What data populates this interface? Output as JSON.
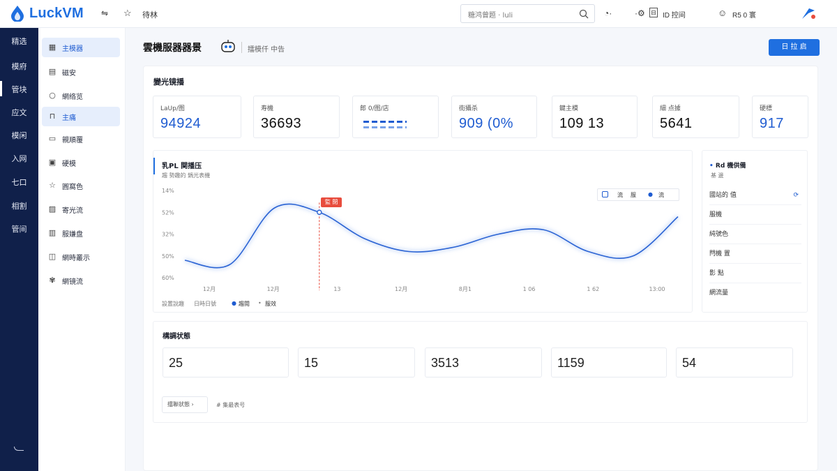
{
  "app": {
    "brand": "LuckVM"
  },
  "topbar": {
    "nav_label": "待林",
    "search_placeholder": "糖鸿曾题 · luli",
    "right_label": "R5 0 寰",
    "doc_label": "ID 控间"
  },
  "sidebar_dark": [
    "精选",
    "模府",
    "管块",
    "应文",
    "模闲",
    "入网",
    "七口",
    "相割",
    "管间"
  ],
  "sidebar_light": [
    {
      "label": "主模器",
      "icon": "grid-icon"
    },
    {
      "label": "磁安",
      "icon": "disk-icon"
    },
    {
      "label": "網络览",
      "icon": "circle-icon"
    },
    {
      "label": "主痛",
      "icon": "chart-icon"
    },
    {
      "label": "親順覆",
      "icon": "list-icon"
    },
    {
      "label": "硬模",
      "icon": "box-icon"
    },
    {
      "label": "圓窩色",
      "icon": "star-icon"
    },
    {
      "label": "寄光流",
      "icon": "image-icon"
    },
    {
      "label": "服嫌盘",
      "icon": "server-icon"
    },
    {
      "label": "網時叢示",
      "icon": "clock-icon"
    },
    {
      "label": "網镜流",
      "icon": "gear-icon"
    }
  ],
  "page": {
    "title": "雲機服器器景",
    "subtitle": "擂模仟 中告",
    "primary_button": "日 拉 启"
  },
  "overview": {
    "title": "變光镜播",
    "kpis": [
      {
        "label": "LaUp/图",
        "value": "94924",
        "color": "#1f5cd1"
      },
      {
        "label": "寿機",
        "value": "36693",
        "color": "#111111"
      },
      {
        "label": "郎 0/图/店",
        "value": "",
        "color": "#1f5cd1"
      },
      {
        "label": "街攝杀",
        "value": "909 (0%",
        "color": "#1f5cd1"
      },
      {
        "label": "鍵主模",
        "value": "109 13",
        "color": "#111111"
      },
      {
        "label": "細 点據",
        "value": "5641",
        "color": "#111111"
      },
      {
        "label": "硬標",
        "value": "917",
        "color": "#1f5cd1"
      }
    ]
  },
  "trend": {
    "title": "乳PL 関播压",
    "subtitle": "趨 勢趣的  鍋光表機",
    "legend": [
      "流",
      "服",
      "流"
    ],
    "tooltip": "監 閉",
    "footer": [
      "設置說趣",
      "日時日號",
      "趨閱",
      "服效"
    ]
  },
  "chart_data": {
    "type": "line",
    "x": [
      "12月",
      "12月",
      "13",
      "12月",
      "8月1",
      "1 06",
      "1 62",
      "13:00"
    ],
    "y_ticks": [
      "14%",
      "52%",
      "32%",
      "50%",
      "60%"
    ],
    "series": [
      {
        "values": [
          0.2,
          0.15,
          0.8,
          0.75,
          0.45,
          0.3,
          0.35,
          0.5,
          0.55,
          0.3,
          0.25,
          0.7
        ]
      }
    ],
    "highlight_index": 3
  },
  "right_panel": {
    "title": "Rd 機供備",
    "subtitle": "基 邊",
    "rows": [
      "國站的 值",
      "服機",
      "純號色",
      "閂機 置",
      "影 點",
      "網流量"
    ]
  },
  "stats": {
    "title": "構調状態",
    "values": [
      "25",
      "15",
      "3513",
      "1159",
      "54"
    ],
    "footer_a": "擂聯狀態",
    "footer_b": "# 集最表号"
  },
  "colors": {
    "accent": "#1f6fe0",
    "nav_bg": "#10204a",
    "alert": "#e84c3d"
  }
}
